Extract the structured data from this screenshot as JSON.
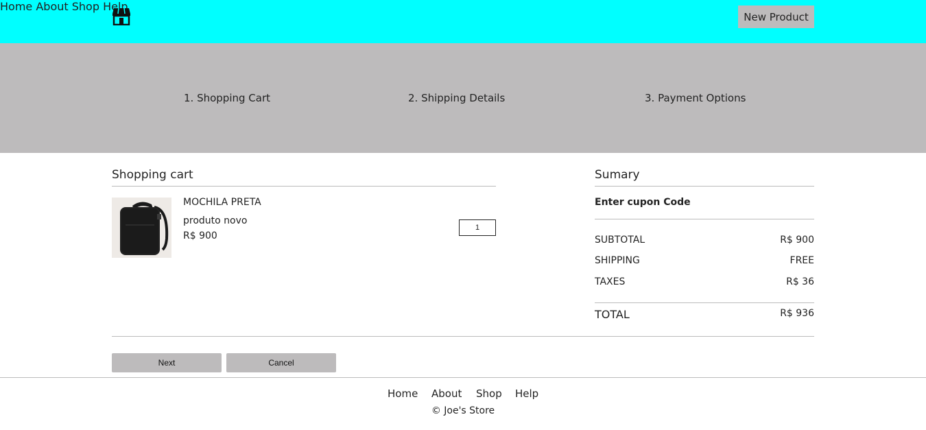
{
  "header": {
    "logo_icon": "store-icon",
    "nav": [
      "Home",
      "About",
      "Shop",
      "Help"
    ],
    "new_product": "New Product",
    "bg_color": "#00ffff"
  },
  "steps": [
    "1. Shopping Cart",
    "2. Shipping Details",
    "3. Payment Options"
  ],
  "cart": {
    "title": "Shopping cart",
    "item": {
      "name": "MOCHILA PRETA",
      "description": "produto novo",
      "price": "R$ 900",
      "quantity": "1",
      "image_icon": "backpack-icon"
    }
  },
  "summary": {
    "title": "Sumary",
    "coupon_label": "Enter cupon Code",
    "subtotal_label": "SUBTOTAL",
    "subtotal_value": "R$ 900",
    "shipping_label": "SHIPPING",
    "shipping_value": "FREE",
    "taxes_label": "TAXES",
    "taxes_value": "R$ 36",
    "total_label": "TOTAL",
    "total_value": "R$ 936"
  },
  "actions": {
    "next": "Next",
    "cancel": "Cancel"
  },
  "footer": {
    "links": [
      "Home",
      "About",
      "Shop",
      "Help"
    ],
    "copyright": "© Joe's Store"
  }
}
